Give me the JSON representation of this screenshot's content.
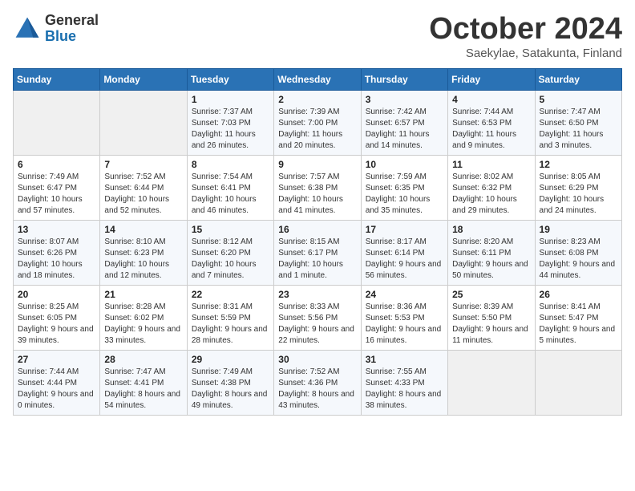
{
  "header": {
    "logo_general": "General",
    "logo_blue": "Blue",
    "month_title": "October 2024",
    "location": "Saekylae, Satakunta, Finland"
  },
  "weekdays": [
    "Sunday",
    "Monday",
    "Tuesday",
    "Wednesday",
    "Thursday",
    "Friday",
    "Saturday"
  ],
  "weeks": [
    [
      {
        "day": "",
        "content": ""
      },
      {
        "day": "",
        "content": ""
      },
      {
        "day": "1",
        "content": "Sunrise: 7:37 AM\nSunset: 7:03 PM\nDaylight: 11 hours\nand 26 minutes."
      },
      {
        "day": "2",
        "content": "Sunrise: 7:39 AM\nSunset: 7:00 PM\nDaylight: 11 hours\nand 20 minutes."
      },
      {
        "day": "3",
        "content": "Sunrise: 7:42 AM\nSunset: 6:57 PM\nDaylight: 11 hours\nand 14 minutes."
      },
      {
        "day": "4",
        "content": "Sunrise: 7:44 AM\nSunset: 6:53 PM\nDaylight: 11 hours\nand 9 minutes."
      },
      {
        "day": "5",
        "content": "Sunrise: 7:47 AM\nSunset: 6:50 PM\nDaylight: 11 hours\nand 3 minutes."
      }
    ],
    [
      {
        "day": "6",
        "content": "Sunrise: 7:49 AM\nSunset: 6:47 PM\nDaylight: 10 hours\nand 57 minutes."
      },
      {
        "day": "7",
        "content": "Sunrise: 7:52 AM\nSunset: 6:44 PM\nDaylight: 10 hours\nand 52 minutes."
      },
      {
        "day": "8",
        "content": "Sunrise: 7:54 AM\nSunset: 6:41 PM\nDaylight: 10 hours\nand 46 minutes."
      },
      {
        "day": "9",
        "content": "Sunrise: 7:57 AM\nSunset: 6:38 PM\nDaylight: 10 hours\nand 41 minutes."
      },
      {
        "day": "10",
        "content": "Sunrise: 7:59 AM\nSunset: 6:35 PM\nDaylight: 10 hours\nand 35 minutes."
      },
      {
        "day": "11",
        "content": "Sunrise: 8:02 AM\nSunset: 6:32 PM\nDaylight: 10 hours\nand 29 minutes."
      },
      {
        "day": "12",
        "content": "Sunrise: 8:05 AM\nSunset: 6:29 PM\nDaylight: 10 hours\nand 24 minutes."
      }
    ],
    [
      {
        "day": "13",
        "content": "Sunrise: 8:07 AM\nSunset: 6:26 PM\nDaylight: 10 hours\nand 18 minutes."
      },
      {
        "day": "14",
        "content": "Sunrise: 8:10 AM\nSunset: 6:23 PM\nDaylight: 10 hours\nand 12 minutes."
      },
      {
        "day": "15",
        "content": "Sunrise: 8:12 AM\nSunset: 6:20 PM\nDaylight: 10 hours\nand 7 minutes."
      },
      {
        "day": "16",
        "content": "Sunrise: 8:15 AM\nSunset: 6:17 PM\nDaylight: 10 hours\nand 1 minute."
      },
      {
        "day": "17",
        "content": "Sunrise: 8:17 AM\nSunset: 6:14 PM\nDaylight: 9 hours\nand 56 minutes."
      },
      {
        "day": "18",
        "content": "Sunrise: 8:20 AM\nSunset: 6:11 PM\nDaylight: 9 hours\nand 50 minutes."
      },
      {
        "day": "19",
        "content": "Sunrise: 8:23 AM\nSunset: 6:08 PM\nDaylight: 9 hours\nand 44 minutes."
      }
    ],
    [
      {
        "day": "20",
        "content": "Sunrise: 8:25 AM\nSunset: 6:05 PM\nDaylight: 9 hours\nand 39 minutes."
      },
      {
        "day": "21",
        "content": "Sunrise: 8:28 AM\nSunset: 6:02 PM\nDaylight: 9 hours\nand 33 minutes."
      },
      {
        "day": "22",
        "content": "Sunrise: 8:31 AM\nSunset: 5:59 PM\nDaylight: 9 hours\nand 28 minutes."
      },
      {
        "day": "23",
        "content": "Sunrise: 8:33 AM\nSunset: 5:56 PM\nDaylight: 9 hours\nand 22 minutes."
      },
      {
        "day": "24",
        "content": "Sunrise: 8:36 AM\nSunset: 5:53 PM\nDaylight: 9 hours\nand 16 minutes."
      },
      {
        "day": "25",
        "content": "Sunrise: 8:39 AM\nSunset: 5:50 PM\nDaylight: 9 hours\nand 11 minutes."
      },
      {
        "day": "26",
        "content": "Sunrise: 8:41 AM\nSunset: 5:47 PM\nDaylight: 9 hours\nand 5 minutes."
      }
    ],
    [
      {
        "day": "27",
        "content": "Sunrise: 7:44 AM\nSunset: 4:44 PM\nDaylight: 9 hours\nand 0 minutes."
      },
      {
        "day": "28",
        "content": "Sunrise: 7:47 AM\nSunset: 4:41 PM\nDaylight: 8 hours\nand 54 minutes."
      },
      {
        "day": "29",
        "content": "Sunrise: 7:49 AM\nSunset: 4:38 PM\nDaylight: 8 hours\nand 49 minutes."
      },
      {
        "day": "30",
        "content": "Sunrise: 7:52 AM\nSunset: 4:36 PM\nDaylight: 8 hours\nand 43 minutes."
      },
      {
        "day": "31",
        "content": "Sunrise: 7:55 AM\nSunset: 4:33 PM\nDaylight: 8 hours\nand 38 minutes."
      },
      {
        "day": "",
        "content": ""
      },
      {
        "day": "",
        "content": ""
      }
    ]
  ]
}
